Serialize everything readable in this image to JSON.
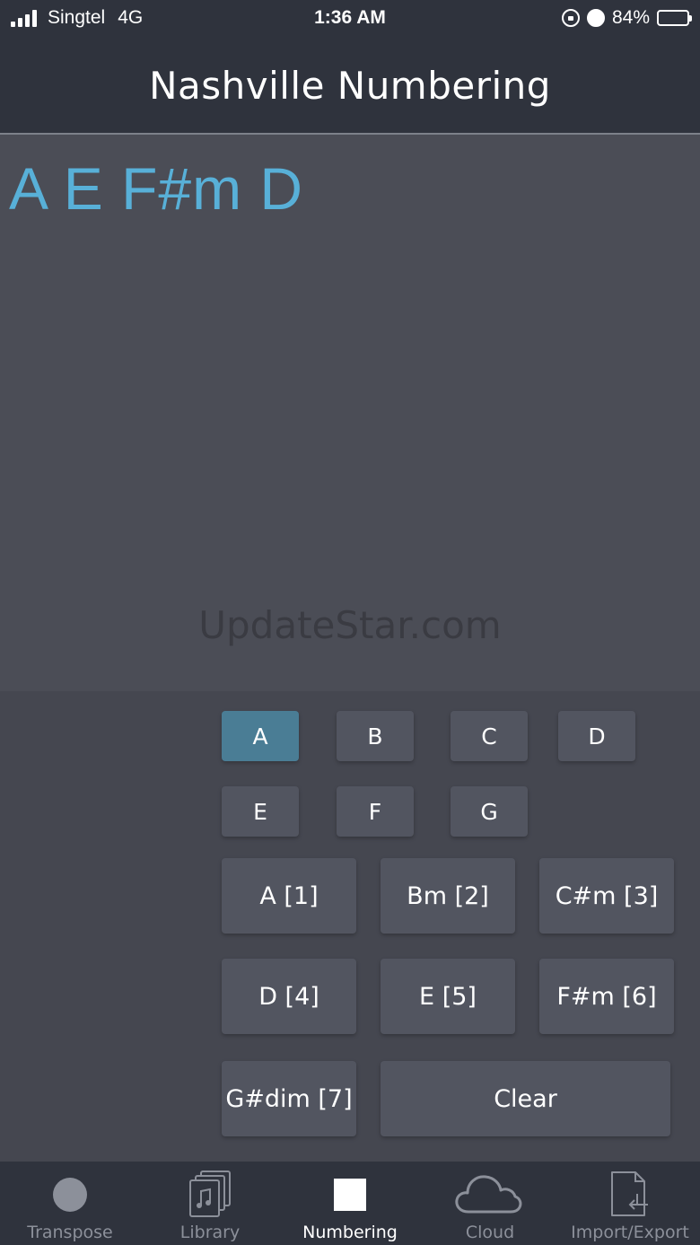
{
  "status_bar": {
    "carrier": "Singtel",
    "network": "4G",
    "time": "1:36 AM",
    "battery": "84%",
    "battery_level": 0.84
  },
  "header": {
    "title": "Nashville Numbering"
  },
  "display": {
    "progression": "A E F#m D",
    "watermark": "UpdateStar.com"
  },
  "keys": {
    "notes": [
      "A",
      "B",
      "C",
      "D",
      "E",
      "F",
      "G"
    ],
    "selected_note": "A",
    "chords": [
      "A [1]",
      "Bm [2]",
      "C#m [3]",
      "D [4]",
      "E [5]",
      "F#m [6]",
      "G#dim [7]"
    ],
    "clear_label": "Clear"
  },
  "tabs": [
    {
      "label": "Transpose",
      "icon": "circle-icon"
    },
    {
      "label": "Library",
      "icon": "music-stack-icon"
    },
    {
      "label": "Numbering",
      "icon": "square-icon",
      "selected": true
    },
    {
      "label": "Cloud",
      "icon": "cloud-icon"
    },
    {
      "label": "Import/Export",
      "icon": "import-export-icon"
    }
  ],
  "colors": {
    "accent": "#58b0d8",
    "selected_key": "#4a7d95",
    "bar_background": "#2f333d"
  }
}
